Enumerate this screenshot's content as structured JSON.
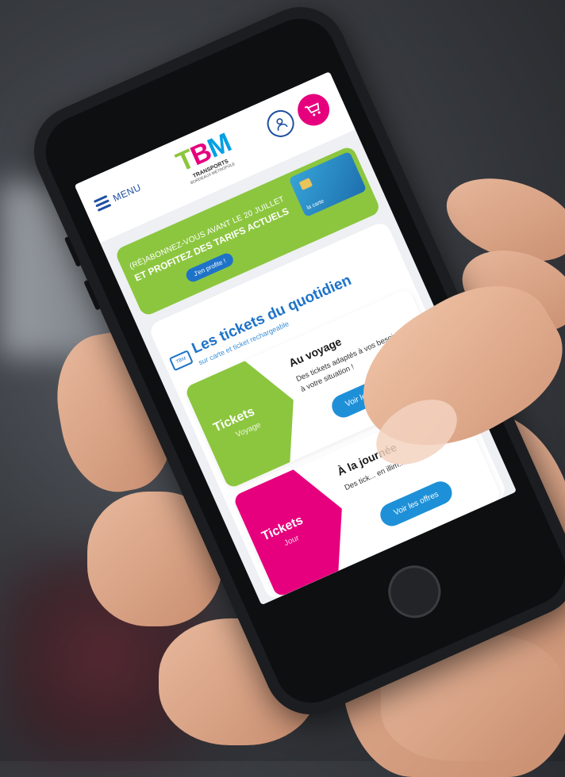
{
  "header": {
    "menu_label": "MENU",
    "logo_letters": [
      "T",
      "B",
      "M"
    ],
    "logo_line1": "TRANSPORTS",
    "logo_line2": "BORDEAUX MÉTROPOLE"
  },
  "banner": {
    "line1": "(RÉ)ABONNEZ-VOUS AVANT LE 20 JUILLET",
    "line2": "ET PROFITEZ DES TARIFS ACTUELS",
    "cta": "J'en profite !",
    "card_label": "la carte"
  },
  "section": {
    "icon_text": "TBM",
    "title": "Les tickets du quotidien",
    "subtitle": "sur carte et ticket rechargeable"
  },
  "tickets": [
    {
      "shape_title": "Tickets",
      "shape_subtitle": "Voyage",
      "heading": "Au voyage",
      "description": "Des tickets adaptés à vos besoins et à votre situation !",
      "cta": "Voir les offres"
    },
    {
      "shape_title": "Tickets",
      "shape_subtitle": "Jour",
      "heading": "À la journée",
      "description": "Des tick... en illim...",
      "cta": "Voir les offres"
    }
  ],
  "colors": {
    "green": "#8cc63f",
    "magenta": "#e6007e",
    "blue": "#1e73c8",
    "cyan": "#00a0e3"
  }
}
